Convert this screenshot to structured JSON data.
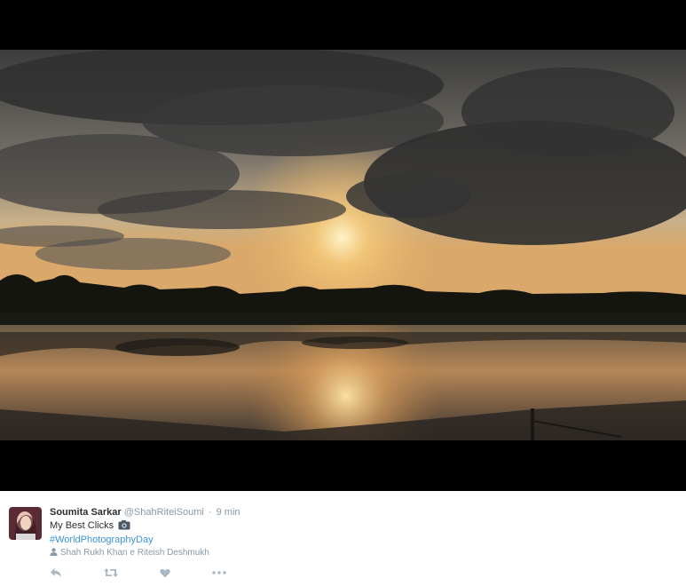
{
  "media": {
    "photo_icon": "sunset-lake-photo"
  },
  "tweet": {
    "author_name": "Soumita Sarkar",
    "handle": "@ShahRiteiSoumi",
    "separator": "·",
    "time": "9 min",
    "text": "My Best Clicks",
    "text_icon": "camera-icon",
    "hashtag": "#WorldPhotographyDay",
    "tagged": "Shah Rukh Khan e Riteish Deshmukh",
    "tagged_icon": "person-icon"
  },
  "actions": {
    "reply_icon": "reply-icon",
    "retweet_icon": "retweet-icon",
    "like_icon": "heart-icon",
    "more_icon": "more-icon"
  },
  "colors": {
    "name": "#292f33",
    "meta": "#8899a6",
    "link": "#3b94d9",
    "icon": "#aab8c2"
  }
}
